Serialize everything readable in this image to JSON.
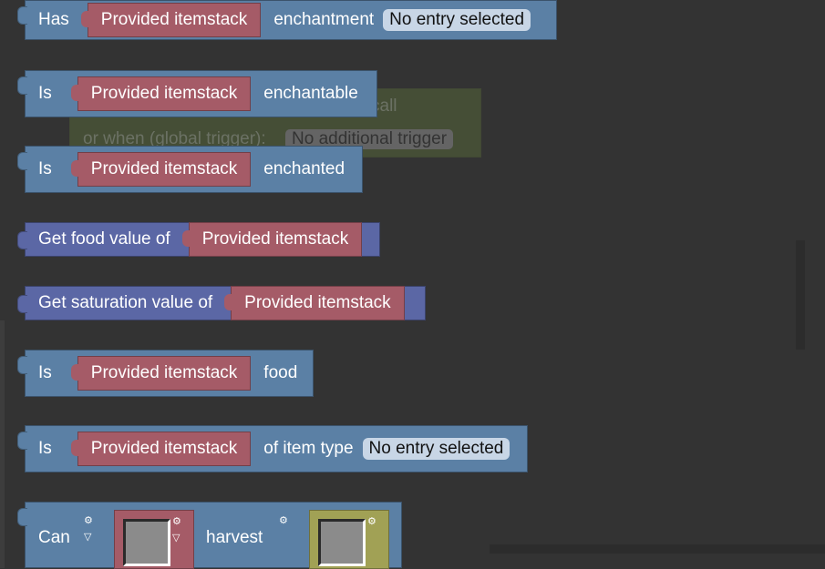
{
  "ghost": {
    "call_text": "call",
    "trigger_prefix": "or when (global trigger):",
    "trigger_value": "No additional trigger"
  },
  "blocks": {
    "has_enchantment": {
      "prefix": "Has",
      "item": "Provided itemstack",
      "suffix": "enchantment",
      "dropdown": "No entry selected"
    },
    "is_enchantable": {
      "prefix": "Is",
      "item": "Provided itemstack",
      "suffix": "enchantable"
    },
    "is_enchanted": {
      "prefix": "Is",
      "item": "Provided itemstack",
      "suffix": "enchanted"
    },
    "food_value": {
      "prefix": "Get food value of",
      "item": "Provided itemstack"
    },
    "saturation_value": {
      "prefix": "Get saturation value of",
      "item": "Provided itemstack"
    },
    "is_food": {
      "prefix": "Is",
      "item": "Provided itemstack",
      "suffix": "food"
    },
    "item_type": {
      "prefix": "Is",
      "item": "Provided itemstack",
      "suffix": "of item type",
      "dropdown": "No entry selected"
    },
    "can_harvest": {
      "prefix": "Can",
      "middle": "harvest"
    }
  },
  "colors": {
    "workspace": "#333333",
    "logic_block": "#5b80a5",
    "math_block": "#5b67a5",
    "itemstack": "#a55b67",
    "blockstate": "#a1a155",
    "dropdown": "#c8d6e6"
  }
}
